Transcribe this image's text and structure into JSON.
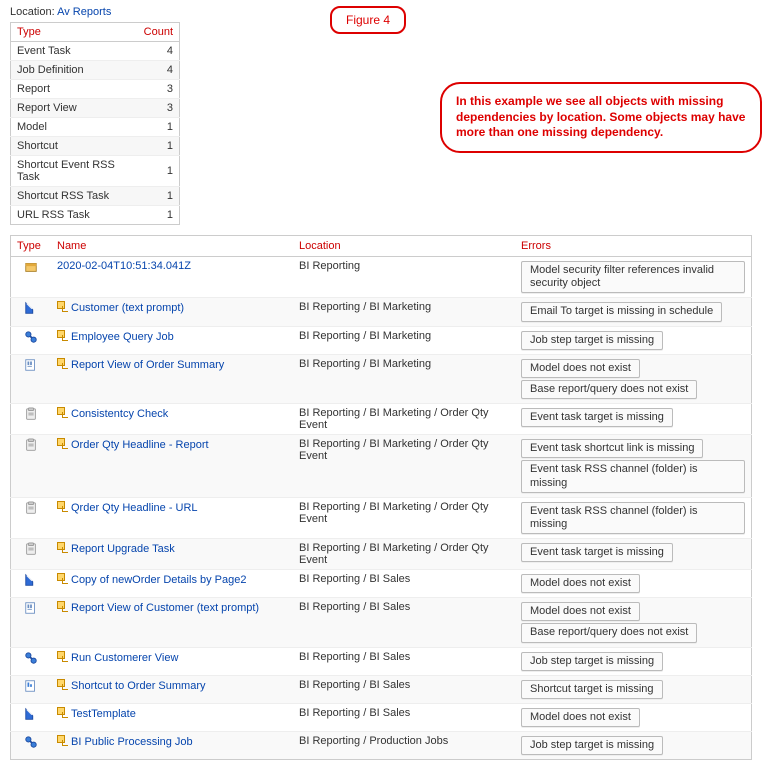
{
  "location_label": "Location:",
  "location_value": "Av Reports",
  "figure_label": "Figure 4",
  "note_text": "In this example we see all objects with missing dependencies by location. Some objects may have more than one missing dependency.",
  "summary": {
    "headers": {
      "type": "Type",
      "count": "Count"
    },
    "rows": [
      {
        "type": "Event Task",
        "count": "4"
      },
      {
        "type": "Job Definition",
        "count": "4"
      },
      {
        "type": "Report",
        "count": "3"
      },
      {
        "type": "Report View",
        "count": "3"
      },
      {
        "type": "Model",
        "count": "1"
      },
      {
        "type": "Shortcut",
        "count": "1"
      },
      {
        "type": "Shortcut Event RSS Task",
        "count": "1"
      },
      {
        "type": "Shortcut RSS Task",
        "count": "1"
      },
      {
        "type": "URL RSS Task",
        "count": "1"
      }
    ]
  },
  "grid": {
    "headers": {
      "type": "Type",
      "name": "Name",
      "location": "Location",
      "errors": "Errors"
    },
    "rows": [
      {
        "icon": "package",
        "shortcut": false,
        "name": "2020-02-04T10:51:34.041Z",
        "location": "BI Reporting",
        "errors": [
          "Model security filter references invalid security object"
        ]
      },
      {
        "icon": "model",
        "shortcut": true,
        "name": "Customer (text prompt)",
        "location": "BI Reporting / BI Marketing",
        "errors": [
          "Email To target is missing in schedule"
        ]
      },
      {
        "icon": "job",
        "shortcut": true,
        "name": "Employee Query Job",
        "location": "BI Reporting / BI Marketing",
        "errors": [
          "Job step target is missing"
        ]
      },
      {
        "icon": "report-view",
        "shortcut": true,
        "name": "Report View of Order Summary",
        "location": "BI Reporting / BI Marketing",
        "errors": [
          "Model does not exist",
          "Base report/query does not exist"
        ]
      },
      {
        "icon": "event-task",
        "shortcut": true,
        "name": "Consistentcy Check",
        "location": "BI Reporting / BI Marketing / Order Qty Event",
        "errors": [
          "Event task target is missing"
        ]
      },
      {
        "icon": "event-task",
        "shortcut": true,
        "name": "Order Qty Headline - Report",
        "location": "BI Reporting / BI Marketing / Order Qty Event",
        "errors": [
          "Event task shortcut link is missing",
          "Event task RSS channel (folder) is missing"
        ]
      },
      {
        "icon": "event-task",
        "shortcut": true,
        "name": "Qrder Qty Headline - URL",
        "location": "BI Reporting / BI Marketing / Order Qty Event",
        "errors": [
          "Event task RSS channel (folder) is missing"
        ]
      },
      {
        "icon": "event-task",
        "shortcut": true,
        "name": "Report Upgrade Task",
        "location": "BI Reporting / BI Marketing / Order Qty Event",
        "errors": [
          "Event task target is missing"
        ]
      },
      {
        "icon": "model",
        "shortcut": true,
        "name": "Copy of newOrder Details by Page2",
        "location": "BI Reporting / BI Sales",
        "errors": [
          "Model does not exist"
        ]
      },
      {
        "icon": "report-view",
        "shortcut": true,
        "name": "Report View of Customer (text prompt)",
        "location": "BI Reporting / BI Sales",
        "errors": [
          "Model does not exist",
          "Base report/query does not exist"
        ]
      },
      {
        "icon": "job",
        "shortcut": true,
        "name": "Run Customerer View",
        "location": "BI Reporting / BI Sales",
        "errors": [
          "Job step target is missing"
        ]
      },
      {
        "icon": "shortcut",
        "shortcut": true,
        "name": "Shortcut to Order Summary",
        "location": "BI Reporting / BI Sales",
        "errors": [
          "Shortcut target is missing"
        ]
      },
      {
        "icon": "model",
        "shortcut": true,
        "name": "TestTemplate",
        "location": "BI Reporting / BI Sales",
        "errors": [
          "Model does not exist"
        ]
      },
      {
        "icon": "job",
        "shortcut": true,
        "name": "BI Public Processing Job",
        "location": "BI Reporting / Production Jobs",
        "errors": [
          "Job step target is missing"
        ]
      }
    ]
  },
  "icons": {
    "package": "<svg viewBox='0 0 16 16'><rect x='2' y='4' width='12' height='9' fill='#f5c869' stroke='#a87b1e'/><rect x='2' y='4' width='12' height='3' fill='#e2a93c'/></svg>",
    "model": "<svg viewBox='0 0 16 16'><polygon points='2,14 2,2 10,10 10,14' fill='#2e6bd6' stroke='#1d4aa0'/><line x1='3' y1='3' x2='9' y2='9' stroke='#fff'/></svg>",
    "job": "<svg viewBox='0 0 16 16'><circle cx='5' cy='5' r='3' fill='#3a7ed8' stroke='#1d4aa0'/><circle cx='11' cy='11' r='3' fill='#3a7ed8' stroke='#1d4aa0'/><line x1='7' y1='7' x2='9' y2='9' stroke='#1d4aa0' stroke-width='2'/></svg>",
    "report-view": "<svg viewBox='0 0 16 16'><rect x='2' y='2' width='10' height='12' fill='#fff' stroke='#6b8fc2'/><rect x='4' y='4' width='2' height='4' fill='#6b8fc2'/><rect x='7' y='4' width='2' height='4' fill='#6b8fc2'/><rect x='4' y='9' width='5' height='1' fill='#6b8fc2'/></svg>",
    "event-task": "<svg viewBox='0 0 16 16'><rect x='3' y='2' width='10' height='12' rx='1' fill='#eee' stroke='#999'/><rect x='5' y='1' width='6' height='3' rx='1' fill='#ccc' stroke='#999'/><line x1='5' y1='7' x2='11' y2='7' stroke='#999'/><line x1='5' y1='9' x2='11' y2='9' stroke='#999'/></svg>",
    "shortcut": "<svg viewBox='0 0 16 16'><rect x='2' y='2' width='10' height='12' fill='#fff' stroke='#6b8fc2'/><rect x='4' y='4' width='2' height='5' fill='#3a7ed8'/><rect x='7' y='6' width='2' height='3' fill='#3a7ed8'/></svg>"
  }
}
